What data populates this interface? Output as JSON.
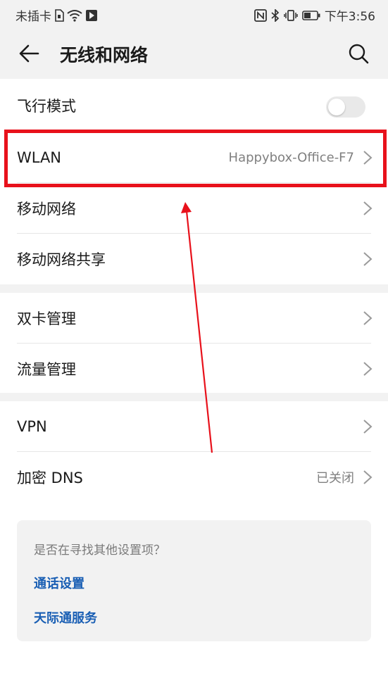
{
  "status_bar": {
    "carrier": "未插卡",
    "time": "下午3:56"
  },
  "header": {
    "title": "无线和网络"
  },
  "settings": {
    "airplane": {
      "label": "飞行模式",
      "enabled": false
    },
    "wlan": {
      "label": "WLAN",
      "value": "Happybox-Office-F7"
    },
    "mobile_network": {
      "label": "移动网络"
    },
    "tethering": {
      "label": "移动网络共享"
    },
    "dual_sim": {
      "label": "双卡管理"
    },
    "data_usage": {
      "label": "流量管理"
    },
    "vpn": {
      "label": "VPN"
    },
    "private_dns": {
      "label": "加密 DNS",
      "value": "已关闭"
    }
  },
  "suggestions": {
    "prompt": "是否在寻找其他设置项？",
    "links": [
      "通话设置",
      "天际通服务"
    ]
  },
  "annotations": {
    "highlight_color": "#e8111b"
  }
}
